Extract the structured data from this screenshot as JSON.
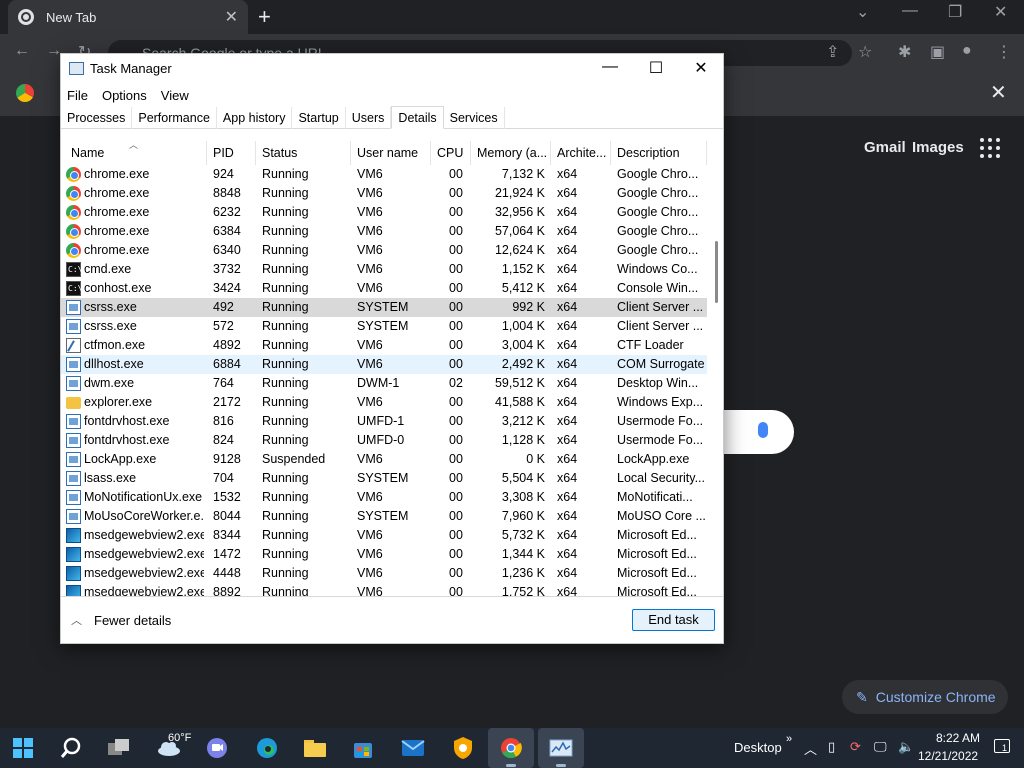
{
  "browser": {
    "tab_title": "New Tab",
    "omnibox_placeholder": "Search Google or type a URL",
    "gmail": "Gmail",
    "images": "Images",
    "customize": "Customize Chrome"
  },
  "window": {
    "title": "Task Manager",
    "menu": [
      "File",
      "Options",
      "View"
    ],
    "tabs": [
      "Processes",
      "Performance",
      "App history",
      "Startup",
      "Users",
      "Details",
      "Services"
    ],
    "active_tab": "Details"
  },
  "table": {
    "columns": [
      "Name",
      "PID",
      "Status",
      "User name",
      "CPU",
      "Memory (a...",
      "Archite...",
      "Description"
    ],
    "rows": [
      {
        "icon": "chrome",
        "name": "chrome.exe",
        "pid": "924",
        "status": "Running",
        "user": "VM6",
        "cpu": "00",
        "mem": "7,132 K",
        "arch": "x64",
        "desc": "Google Chro..."
      },
      {
        "icon": "chrome",
        "name": "chrome.exe",
        "pid": "8848",
        "status": "Running",
        "user": "VM6",
        "cpu": "00",
        "mem": "21,924 K",
        "arch": "x64",
        "desc": "Google Chro..."
      },
      {
        "icon": "chrome",
        "name": "chrome.exe",
        "pid": "6232",
        "status": "Running",
        "user": "VM6",
        "cpu": "00",
        "mem": "32,956 K",
        "arch": "x64",
        "desc": "Google Chro..."
      },
      {
        "icon": "chrome",
        "name": "chrome.exe",
        "pid": "6384",
        "status": "Running",
        "user": "VM6",
        "cpu": "00",
        "mem": "57,064 K",
        "arch": "x64",
        "desc": "Google Chro..."
      },
      {
        "icon": "chrome",
        "name": "chrome.exe",
        "pid": "6340",
        "status": "Running",
        "user": "VM6",
        "cpu": "00",
        "mem": "12,624 K",
        "arch": "x64",
        "desc": "Google Chro..."
      },
      {
        "icon": "console",
        "name": "cmd.exe",
        "pid": "3732",
        "status": "Running",
        "user": "VM6",
        "cpu": "00",
        "mem": "1,152 K",
        "arch": "x64",
        "desc": "Windows Co..."
      },
      {
        "icon": "console",
        "name": "conhost.exe",
        "pid": "3424",
        "status": "Running",
        "user": "VM6",
        "cpu": "00",
        "mem": "5,412 K",
        "arch": "x64",
        "desc": "Console Win..."
      },
      {
        "icon": "sys",
        "name": "csrss.exe",
        "pid": "492",
        "status": "Running",
        "user": "SYSTEM",
        "cpu": "00",
        "mem": "992 K",
        "arch": "x64",
        "desc": "Client Server ...",
        "state": "selected"
      },
      {
        "icon": "sys",
        "name": "csrss.exe",
        "pid": "572",
        "status": "Running",
        "user": "SYSTEM",
        "cpu": "00",
        "mem": "1,004 K",
        "arch": "x64",
        "desc": "Client Server ..."
      },
      {
        "icon": "ctf",
        "name": "ctfmon.exe",
        "pid": "4892",
        "status": "Running",
        "user": "VM6",
        "cpu": "00",
        "mem": "3,004 K",
        "arch": "x64",
        "desc": "CTF Loader"
      },
      {
        "icon": "sys",
        "name": "dllhost.exe",
        "pid": "6884",
        "status": "Running",
        "user": "VM6",
        "cpu": "00",
        "mem": "2,492 K",
        "arch": "x64",
        "desc": "COM Surrogate",
        "state": "hover"
      },
      {
        "icon": "sys",
        "name": "dwm.exe",
        "pid": "764",
        "status": "Running",
        "user": "DWM-1",
        "cpu": "02",
        "mem": "59,512 K",
        "arch": "x64",
        "desc": "Desktop Win..."
      },
      {
        "icon": "folder",
        "name": "explorer.exe",
        "pid": "2172",
        "status": "Running",
        "user": "VM6",
        "cpu": "00",
        "mem": "41,588 K",
        "arch": "x64",
        "desc": "Windows Exp..."
      },
      {
        "icon": "sys",
        "name": "fontdrvhost.exe",
        "pid": "816",
        "status": "Running",
        "user": "UMFD-1",
        "cpu": "00",
        "mem": "3,212 K",
        "arch": "x64",
        "desc": "Usermode Fo..."
      },
      {
        "icon": "sys",
        "name": "fontdrvhost.exe",
        "pid": "824",
        "status": "Running",
        "user": "UMFD-0",
        "cpu": "00",
        "mem": "1,128 K",
        "arch": "x64",
        "desc": "Usermode Fo..."
      },
      {
        "icon": "sys",
        "name": "LockApp.exe",
        "pid": "9128",
        "status": "Suspended",
        "user": "VM6",
        "cpu": "00",
        "mem": "0 K",
        "arch": "x64",
        "desc": "LockApp.exe"
      },
      {
        "icon": "sys",
        "name": "lsass.exe",
        "pid": "704",
        "status": "Running",
        "user": "SYSTEM",
        "cpu": "00",
        "mem": "5,504 K",
        "arch": "x64",
        "desc": "Local Security..."
      },
      {
        "icon": "sys",
        "name": "MoNotificationUx.exe",
        "pid": "1532",
        "status": "Running",
        "user": "VM6",
        "cpu": "00",
        "mem": "3,308 K",
        "arch": "x64",
        "desc": "MoNotificati..."
      },
      {
        "icon": "sys",
        "name": "MoUsoCoreWorker.e...",
        "pid": "8044",
        "status": "Running",
        "user": "SYSTEM",
        "cpu": "00",
        "mem": "7,960 K",
        "arch": "x64",
        "desc": "MoUSO Core ..."
      },
      {
        "icon": "edge",
        "name": "msedgewebview2.exe",
        "pid": "8344",
        "status": "Running",
        "user": "VM6",
        "cpu": "00",
        "mem": "5,732 K",
        "arch": "x64",
        "desc": "Microsoft Ed..."
      },
      {
        "icon": "edge",
        "name": "msedgewebview2.exe",
        "pid": "1472",
        "status": "Running",
        "user": "VM6",
        "cpu": "00",
        "mem": "1,344 K",
        "arch": "x64",
        "desc": "Microsoft Ed..."
      },
      {
        "icon": "edge",
        "name": "msedgewebview2.exe",
        "pid": "4448",
        "status": "Running",
        "user": "VM6",
        "cpu": "00",
        "mem": "1,236 K",
        "arch": "x64",
        "desc": "Microsoft Ed..."
      },
      {
        "icon": "edge",
        "name": "msedgewebview2.exe",
        "pid": "8892",
        "status": "Running",
        "user": "VM6",
        "cpu": "00",
        "mem": "1,752 K",
        "arch": "x64",
        "desc": "Microsoft Ed..."
      }
    ]
  },
  "footer": {
    "fewer_details": "Fewer details",
    "end_task": "End task"
  },
  "taskbar": {
    "weather": "60°F",
    "desktop": "Desktop",
    "time": "8:22 AM",
    "date": "12/21/2022",
    "notifications": "1"
  },
  "colors": {
    "selected_row": "#d9d9d9",
    "hover_row": "#e5f3ff",
    "accent": "#0078d4",
    "taskbar": "#1f2733"
  }
}
